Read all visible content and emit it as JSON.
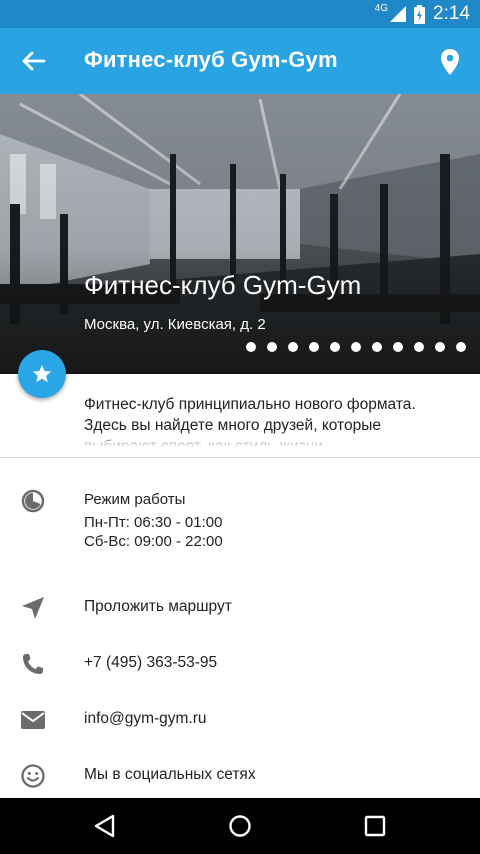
{
  "status_bar": {
    "network": "4G",
    "time": "2:14"
  },
  "toolbar": {
    "title": "Фитнес-клуб Gym-Gym"
  },
  "hero": {
    "title": "Фитнес-клуб Gym-Gym",
    "address": "Москва, ул. Киевская, д. 2",
    "gallery_dots": 11
  },
  "description": "Фитнес-клуб принципиально нового формата. Здесь вы найдете много друзей, которые выбирают спорт, как стиль жизни",
  "hours": {
    "label": "Режим работы",
    "weekdays": "Пн-Пт: 06:30 - 01:00",
    "weekend": "Сб-Вс: 09:00 - 22:00"
  },
  "actions": {
    "route": "Проложить маршрут",
    "phone": "+7 (495) 363-53-95",
    "email": "info@gym-gym.ru",
    "social": "Мы в социальных сетях"
  },
  "colors": {
    "toolbar": "#29a3e1",
    "status_bar": "#1e88c8",
    "fab": "#2aa5e5"
  }
}
